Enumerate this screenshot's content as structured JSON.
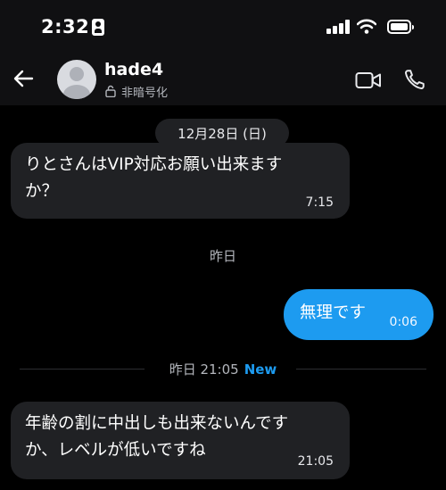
{
  "status_bar": {
    "time": "2:32"
  },
  "header": {
    "contact_name": "hade4",
    "encryption_status": "非暗号化"
  },
  "conversation": {
    "date_chip": "12月28日 (日)",
    "messages": [
      {
        "direction": "incoming",
        "text": "りとさんはVIP対応お願い出来ます\nか？",
        "time": "7:15"
      },
      {
        "direction": "outgoing",
        "text": "無理です",
        "time": "0:06"
      },
      {
        "direction": "incoming",
        "text": "年齢の割に中出しも出来ないんです\nか、レベルが低いですね",
        "time": "21:05"
      }
    ],
    "separators": {
      "yesterday": "昨日"
    },
    "new_separator": {
      "label": "昨日 21:05",
      "badge": "New"
    }
  },
  "colors": {
    "background": "#000000",
    "incoming_bubble": "#202124",
    "outgoing_bubble": "#1d9bf0",
    "accent": "#1d9bf0"
  },
  "icons": [
    "id-card-icon",
    "signal-icon",
    "wifi-icon",
    "battery-icon",
    "back-arrow-icon",
    "avatar",
    "lock-icon",
    "video-call-icon",
    "phone-call-icon"
  ]
}
